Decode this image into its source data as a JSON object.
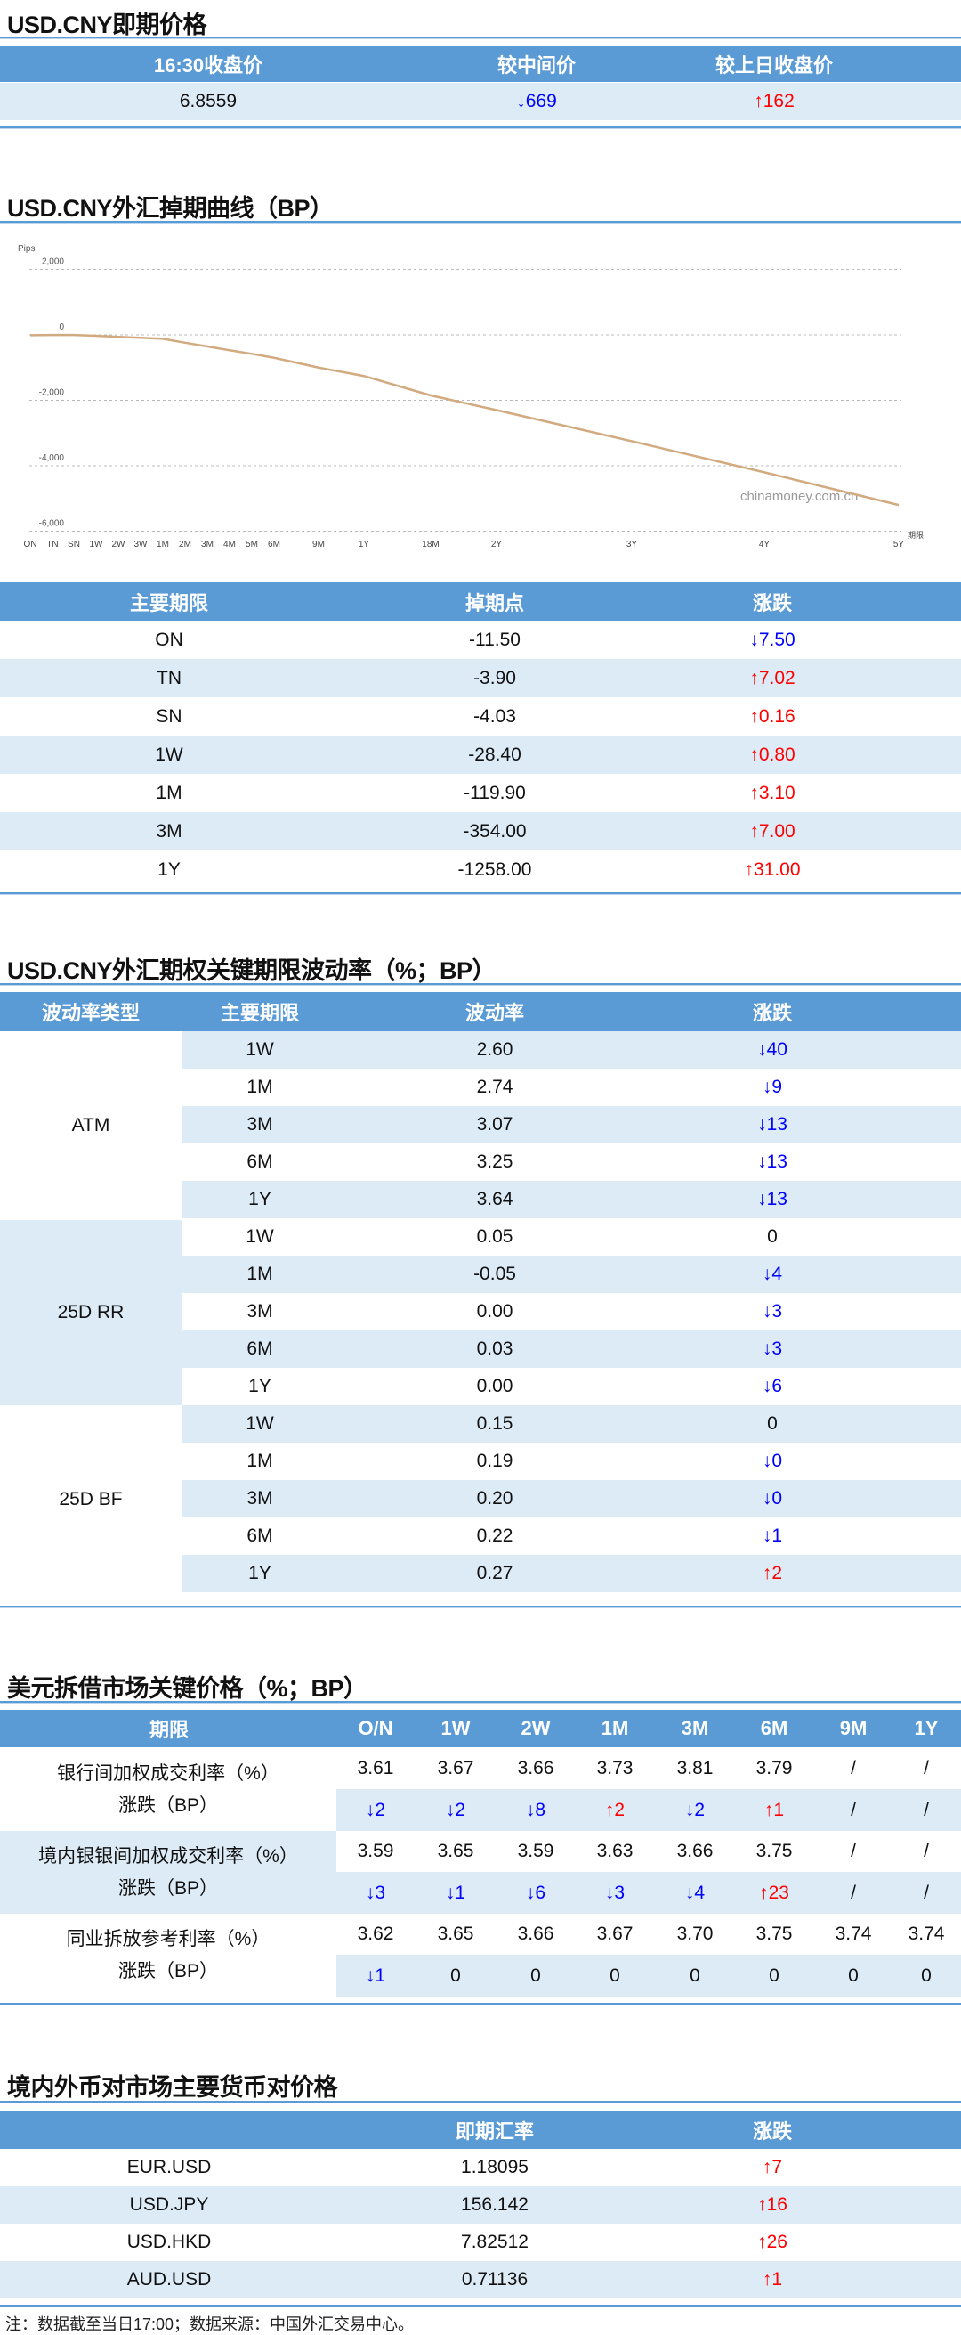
{
  "spot": {
    "title": "USD.CNY即期价格",
    "headers": [
      "16:30收盘价",
      "较中间价",
      "较上日收盘价"
    ],
    "values": [
      "6.8559",
      "↓669",
      "↑162"
    ]
  },
  "swap_chart": {
    "title": "USD.CNY外汇掉期曲线（BP）"
  },
  "chart_data": {
    "type": "line",
    "title": "USD.CNY外汇掉期曲线（BP）",
    "ylabel": "Pips",
    "xlabel": "期限",
    "ylim": [
      -6000,
      2000
    ],
    "yticks": [
      "2,000",
      "0",
      "-2,000",
      "-4,000",
      "-6,000"
    ],
    "ytick_values": [
      2000,
      0,
      -2000,
      -4000,
      -6000
    ],
    "grid": true,
    "watermark": "chinamoney.com.cn",
    "line_color": "#d2aa7f",
    "categories": [
      "ON",
      "TN",
      "SN",
      "1W",
      "2W",
      "3W",
      "1M",
      "2M",
      "3M",
      "4M",
      "5M",
      "6M",
      "9M",
      "1Y",
      "18M",
      "2Y",
      "3Y",
      "4Y",
      "5Y"
    ],
    "values": [
      -11.5,
      -3.9,
      -4.03,
      -28.4,
      -60,
      -90,
      -119.9,
      -240,
      -354,
      -470,
      -580,
      -700,
      -1000,
      -1258,
      -1850,
      -2300,
      -3250,
      -4200,
      -5200
    ]
  },
  "swap": {
    "headers": [
      "主要期限",
      "掉期点",
      "涨跌"
    ],
    "rows": [
      [
        "ON",
        "-11.50",
        "↓7.50"
      ],
      [
        "TN",
        "-3.90",
        "↑7.02"
      ],
      [
        "SN",
        "-4.03",
        "↑0.16"
      ],
      [
        "1W",
        "-28.40",
        "↑0.80"
      ],
      [
        "1M",
        "-119.90",
        "↑3.10"
      ],
      [
        "3M",
        "-354.00",
        "↑7.00"
      ],
      [
        "1Y",
        "-1258.00",
        "↑31.00"
      ]
    ]
  },
  "vol": {
    "title": "USD.CNY外汇期权关键期限波动率（%；BP）",
    "headers": [
      "波动率类型",
      "主要期限",
      "波动率",
      "涨跌"
    ],
    "groups": [
      {
        "type": "ATM",
        "rows": [
          [
            "1W",
            "2.60",
            "↓40"
          ],
          [
            "1M",
            "2.74",
            "↓9"
          ],
          [
            "3M",
            "3.07",
            "↓13"
          ],
          [
            "6M",
            "3.25",
            "↓13"
          ],
          [
            "1Y",
            "3.64",
            "↓13"
          ]
        ]
      },
      {
        "type": "25D RR",
        "rows": [
          [
            "1W",
            "0.05",
            "0"
          ],
          [
            "1M",
            "-0.05",
            "↓4"
          ],
          [
            "3M",
            "0.00",
            "↓3"
          ],
          [
            "6M",
            "0.03",
            "↓3"
          ],
          [
            "1Y",
            "0.00",
            "↓6"
          ]
        ]
      },
      {
        "type": "25D BF",
        "rows": [
          [
            "1W",
            "0.15",
            "0"
          ],
          [
            "1M",
            "0.19",
            "↓0"
          ],
          [
            "3M",
            "0.20",
            "↓0"
          ],
          [
            "6M",
            "0.22",
            "↓1"
          ],
          [
            "1Y",
            "0.27",
            "↑2"
          ]
        ]
      }
    ]
  },
  "lending": {
    "title": "美元拆借市场关键价格（%；BP）",
    "headers": [
      "期限",
      "O/N",
      "1W",
      "2W",
      "1M",
      "3M",
      "6M",
      "9M",
      "1Y"
    ],
    "groups": [
      {
        "name": "银行间加权成交利率（%）",
        "change_label": "涨跌（BP）",
        "rates": [
          "3.61",
          "3.67",
          "3.66",
          "3.73",
          "3.81",
          "3.79",
          "/",
          "/"
        ],
        "changes": [
          "↓2",
          "↓2",
          "↓8",
          "↑2",
          "↓2",
          "↑1",
          "/",
          "/"
        ]
      },
      {
        "name": "境内银银间加权成交利率（%）",
        "change_label": "涨跌（BP）",
        "rates": [
          "3.59",
          "3.65",
          "3.59",
          "3.63",
          "3.66",
          "3.75",
          "/",
          "/"
        ],
        "changes": [
          "↓3",
          "↓1",
          "↓6",
          "↓3",
          "↓4",
          "↑23",
          "/",
          "/"
        ]
      },
      {
        "name": "同业拆放参考利率（%）",
        "change_label": "涨跌（BP）",
        "rates": [
          "3.62",
          "3.65",
          "3.66",
          "3.67",
          "3.70",
          "3.75",
          "3.74",
          "3.74"
        ],
        "changes": [
          "↓1",
          "0",
          "0",
          "0",
          "0",
          "0",
          "0",
          "0"
        ]
      }
    ]
  },
  "fx": {
    "title": "境内外币对市场主要货币对价格",
    "headers": [
      "",
      "即期汇率",
      "涨跌"
    ],
    "rows": [
      [
        "EUR.USD",
        "1.18095",
        "↑7"
      ],
      [
        "USD.JPY",
        "156.142",
        "↑16"
      ],
      [
        "USD.HKD",
        "7.82512",
        "↑26"
      ],
      [
        "AUD.USD",
        "0.71136",
        "↑1"
      ]
    ]
  },
  "footnote": "注：数据截至当日17:00；数据来源：中国外汇交易中心。"
}
